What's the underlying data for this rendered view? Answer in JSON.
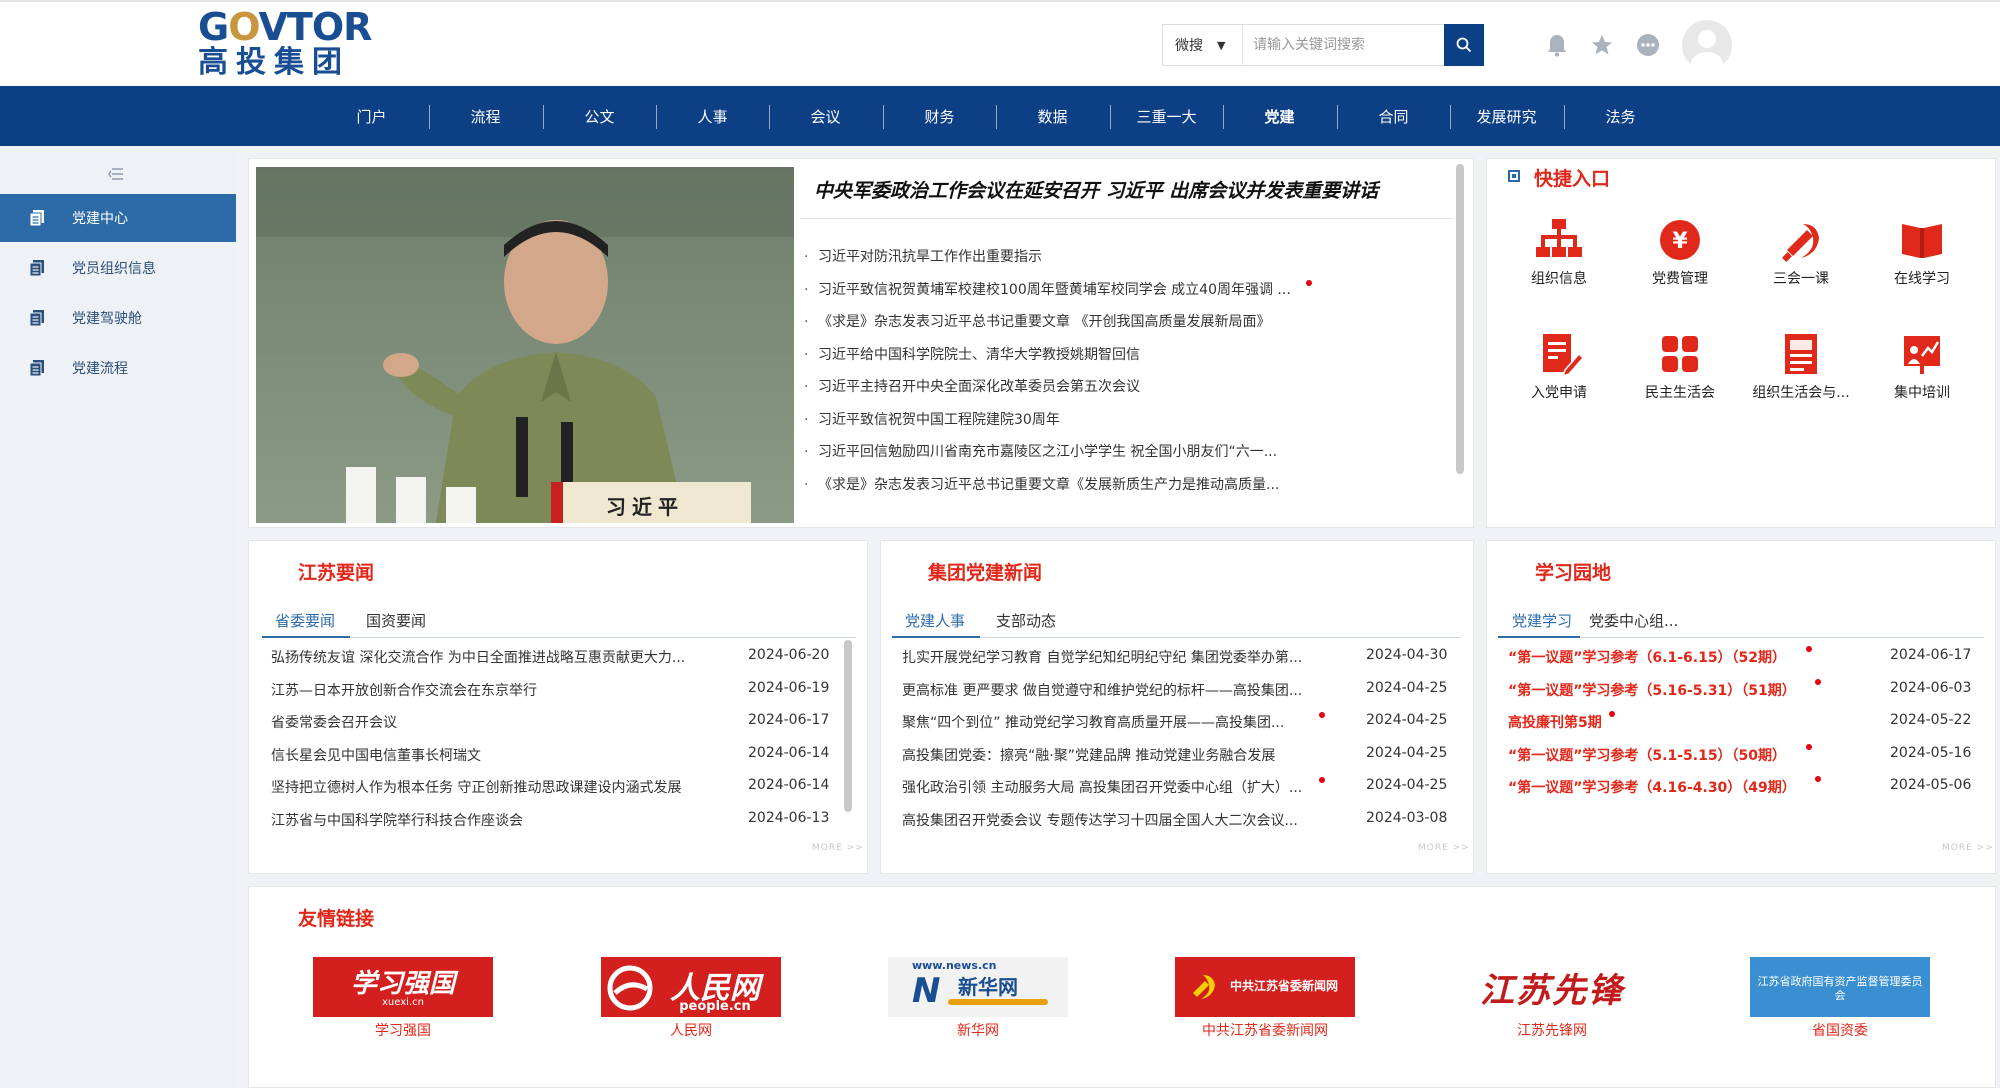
{
  "header": {
    "logo_en_prefix": "G",
    "logo_en_o": "O",
    "logo_en_rest": "VTOR",
    "logo_cn": "高投集团",
    "search_scope": "微搜",
    "search_placeholder": "请输入关键词搜索"
  },
  "nav": [
    "门户",
    "流程",
    "公文",
    "人事",
    "会议",
    "财务",
    "数据",
    "三重一大",
    "党建",
    "合同",
    "发展研究",
    "法务"
  ],
  "nav_active": "党建",
  "sidebar": [
    "党建中心",
    "党员组织信息",
    "党建驾驶舱",
    "党建流程"
  ],
  "feature": {
    "hero_caption": "习近平",
    "title": "中央军委政治工作会议在延安召开 习近平 出席会议并发表重要讲话",
    "items": [
      "习近平对防汛抗旱工作作出重要指示",
      "习近平致信祝贺黄埔军校建校100周年暨黄埔军校同学会 成立40周年强调 ...",
      "《求是》杂志发表习近平总书记重要文章 《开创我国高质量发展新局面》",
      "习近平给中国科学院院士、清华大学教授姚期智回信",
      "习近平主持召开中央全面深化改革委员会第五次会议",
      "习近平致信祝贺中国工程院建院30周年",
      "习近平回信勉励四川省南充市嘉陵区之江小学学生 祝全国小朋友们“六一...",
      "《求是》杂志发表习近平总书记重要文章《发展新质生产力是推动高质量..."
    ]
  },
  "quick_entry": {
    "title": "快捷入口",
    "items": [
      "组织信息",
      "党费管理",
      "三会一课",
      "在线学习",
      "入党申请",
      "民主生活会",
      "组织生活会与...",
      "集中培训"
    ]
  },
  "jiangsu_news": {
    "title": "江苏要闻",
    "tabs": [
      "省委要闻",
      "国资要闻"
    ],
    "rows": [
      {
        "text": "弘扬传统友谊 深化交流合作 为中日全面推进战略互惠贡献更大力...",
        "date": "2024-06-20"
      },
      {
        "text": "江苏—日本开放创新合作交流会在东京举行",
        "date": "2024-06-19"
      },
      {
        "text": "省委常委会召开会议",
        "date": "2024-06-17"
      },
      {
        "text": "信长星会见中国电信董事长柯瑞文",
        "date": "2024-06-14"
      },
      {
        "text": "坚持把立德树人作为根本任务 守正创新推动思政课建设内涵式发展",
        "date": "2024-06-14"
      },
      {
        "text": "江苏省与中国科学院举行科技合作座谈会",
        "date": "2024-06-13"
      }
    ],
    "more": "MORE >>"
  },
  "group_news": {
    "title": "集团党建新闻",
    "tabs": [
      "党建人事",
      "支部动态"
    ],
    "rows": [
      {
        "text": "扎实开展党纪学习教育 自觉学纪知纪明纪守纪 集团党委举办第...",
        "date": "2024-04-30"
      },
      {
        "text": "更高标准 更严要求 做自觉遵守和维护党纪的标杆——高投集团...",
        "date": "2024-04-25"
      },
      {
        "text": "聚焦“四个到位” 推动党纪学习教育高质量开展——高投集团...",
        "date": "2024-04-25"
      },
      {
        "text": "高投集团党委：擦亮“融·聚”党建品牌 推动党建业务融合发展",
        "date": "2024-04-25"
      },
      {
        "text": "强化政治引领 主动服务大局 高投集团召开党委中心组（扩大）...",
        "date": "2024-04-25"
      },
      {
        "text": "高投集团召开党委会议 专题传达学习十四届全国人大二次会议...",
        "date": "2024-03-08"
      }
    ],
    "more": "MORE >>"
  },
  "study": {
    "title": "学习园地",
    "tabs": [
      "党建学习",
      "党委中心组..."
    ],
    "rows": [
      {
        "text": "“第一议题”学习参考（6.1-6.15）（52期）",
        "date": "2024-06-17"
      },
      {
        "text": "“第一议题”学习参考（5.16-5.31）（51期）",
        "date": "2024-06-03"
      },
      {
        "text": "高投廉刊第5期",
        "date": "2024-05-22"
      },
      {
        "text": "“第一议题”学习参考（5.1-5.15）（50期）",
        "date": "2024-05-16"
      },
      {
        "text": "“第一议题”学习参考（4.16-4.30）（49期）",
        "date": "2024-05-06"
      }
    ],
    "more": "MORE >>"
  },
  "links": {
    "title": "友情链接",
    "items": [
      {
        "label": "学习强国",
        "logo_main": "学习强国",
        "logo_sub": "xuexi.cn"
      },
      {
        "label": "人民网",
        "logo_main": "人民网",
        "logo_sub": "people.cn"
      },
      {
        "label": "新华网",
        "logo_main": "新华网",
        "logo_sub": "www.news.cn"
      },
      {
        "label": "中共江苏省委新闻网",
        "logo_main": "中共江苏省委新闻网",
        "logo_sub": ""
      },
      {
        "label": "江苏先锋网",
        "logo_main": "江苏先锋",
        "logo_sub": ""
      },
      {
        "label": "省国资委",
        "logo_main": "江苏省政府国有资产监督管理委员会",
        "logo_sub": ""
      }
    ]
  },
  "colors": {
    "primary": "#0d3f85",
    "accent_red": "#e0281b",
    "sidebar_active": "#2d6ba8"
  }
}
